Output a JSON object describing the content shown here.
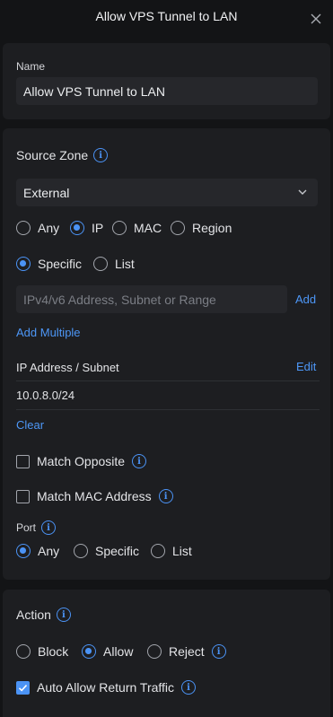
{
  "header": {
    "title": "Allow VPS Tunnel to LAN"
  },
  "name_section": {
    "label": "Name",
    "value": "Allow VPS Tunnel to LAN"
  },
  "source": {
    "title": "Source Zone",
    "zone_value": "External",
    "match_types": [
      "Any",
      "IP",
      "MAC",
      "Region"
    ],
    "selected_match": "IP",
    "modes": [
      "Specific",
      "List"
    ],
    "selected_mode": "Specific",
    "address_placeholder": "IPv4/v6 Address, Subnet or Range",
    "add_label": "Add",
    "add_multiple_label": "Add Multiple",
    "list_header": "IP Address / Subnet",
    "edit_label": "Edit",
    "entries": [
      "10.0.8.0/24"
    ],
    "clear_label": "Clear",
    "match_opposite": "Match Opposite",
    "match_mac": "Match MAC Address",
    "port_label": "Port",
    "port_options": [
      "Any",
      "Specific",
      "List"
    ],
    "selected_port": "Any"
  },
  "action": {
    "title": "Action",
    "options": [
      "Block",
      "Allow",
      "Reject"
    ],
    "selected": "Allow",
    "auto_allow": "Auto Allow Return Traffic",
    "auto_allow_checked": true
  },
  "colors": {
    "accent": "#4b93f5",
    "panel": "#1d1e21",
    "background": "#131416"
  }
}
